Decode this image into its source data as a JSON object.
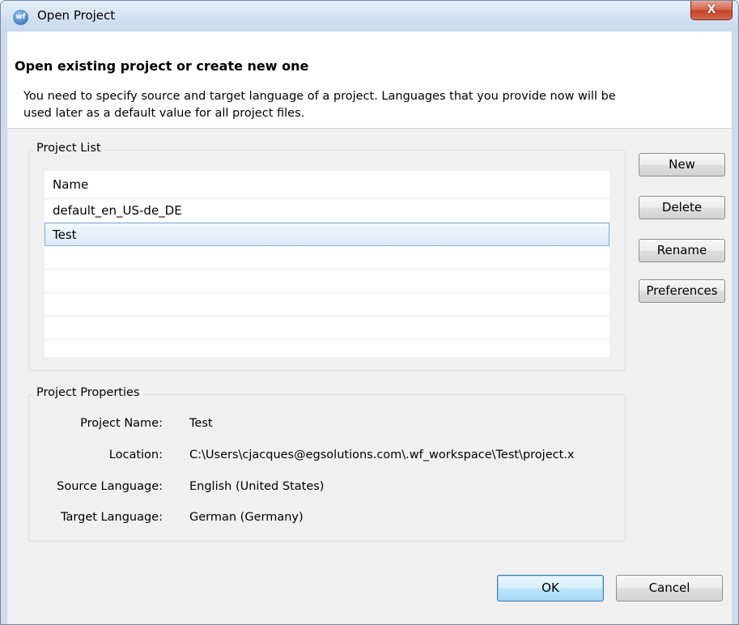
{
  "window": {
    "title": "Open Project",
    "close_label": "X",
    "icon": "app-logo-icon"
  },
  "header": {
    "title": "Open existing project or create new one",
    "description": "You need to specify source and target language of a project. Languages that you provide now will be used later as a default value for all project files."
  },
  "project_list": {
    "group_label": "Project List",
    "column_name": "Name",
    "rows": [
      {
        "name": "default_en_US-de_DE"
      },
      {
        "name": "Test"
      }
    ],
    "selected_index": 1
  },
  "side_buttons": {
    "new_label": "New",
    "delete_label": "Delete",
    "rename_label": "Rename",
    "preferences_label": "Preferences"
  },
  "project_properties": {
    "group_label": "Project Properties",
    "project_name_label": "Project Name:",
    "project_name_value": "Test",
    "location_label": "Location:",
    "location_value": "C:\\Users\\cjacques@egsolutions.com\\.wf_workspace\\Test\\project.x",
    "source_language_label": "Source Language:",
    "source_language_value": "English (United States)",
    "target_language_label": "Target Language:",
    "target_language_value": "German (Germany)"
  },
  "footer": {
    "ok_label": "OK",
    "cancel_label": "Cancel"
  }
}
